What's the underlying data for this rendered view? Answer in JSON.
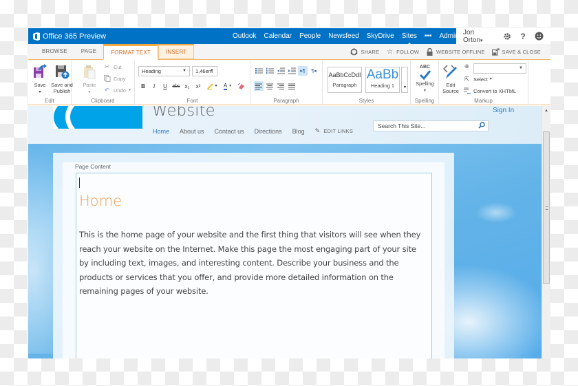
{
  "suite_bar": {
    "brand": "Office 365 Preview",
    "nav": [
      "Outlook",
      "Calendar",
      "People",
      "Newsfeed",
      "SkyDrive",
      "Sites",
      "•••",
      "Admin"
    ],
    "active_nav": "Sites",
    "user": "Jon Orton",
    "icons": [
      "gear-icon",
      "help-icon",
      "smiley-icon"
    ]
  },
  "ribbon_tabs": {
    "tabs": [
      "BROWSE",
      "PAGE",
      "FORMAT TEXT",
      "INSERT"
    ],
    "active": "FORMAT TEXT",
    "commands": [
      {
        "label": "SHARE",
        "icon": "share-icon"
      },
      {
        "label": "FOLLOW",
        "icon": "star-icon"
      },
      {
        "label": "WEBSITE OFFLINE",
        "icon": "lock-icon"
      },
      {
        "label": "SAVE & CLOSE",
        "icon": "save-close-icon"
      }
    ]
  },
  "ribbon": {
    "edit": {
      "label": "Edit",
      "save": "Save",
      "save_publish_line1": "Save and",
      "save_publish_line2": "Publish"
    },
    "clipboard": {
      "label": "Clipboard",
      "paste": "Paste",
      "cut": "Cut",
      "copy": "Copy",
      "undo": "Undo"
    },
    "font": {
      "label": "Font",
      "style_value": "Heading",
      "size_value": "1.46em",
      "buttons": [
        "B",
        "I",
        "U",
        "abc",
        "x₂",
        "x²"
      ]
    },
    "paragraph": {
      "label": "Paragraph"
    },
    "styles": {
      "label": "Styles",
      "items": [
        {
          "sample": "AaBbCcDdI",
          "name": "Paragraph"
        },
        {
          "sample": "AaBb",
          "name": "Heading 1"
        }
      ]
    },
    "spelling": {
      "label": "Spelling",
      "button": "Spelling",
      "abc": "ABC"
    },
    "markup": {
      "label": "Markup",
      "edit_source_line1": "Edit",
      "edit_source_line2": "Source",
      "select": "Select",
      "convert": "Convert to XHTML",
      "language_value": ""
    }
  },
  "site": {
    "title": "Website",
    "sign_in": "Sign In",
    "nav": [
      "Home",
      "About us",
      "Contact us",
      "Directions",
      "Blog"
    ],
    "active_nav": "Home",
    "edit_links": "EDIT LINKS",
    "search_placeholder": "Search This Site..."
  },
  "content": {
    "label": "Page Content",
    "heading": "Home",
    "body": "This is the home page of your website and the first thing that visitors will see when they reach your website on the Internet. Make this page the most engaging part of your site by including text, images, and interesting content. Describe your business and the products or services that you offer, and provide more detailed information on the remaining pages of your website."
  },
  "colors": {
    "suite_blue": "#0072c6",
    "ribbon_accent": "#f5a83f",
    "active_tab_text": "#d2691e",
    "link_blue": "#2a7ac2",
    "heading_orange": "#f39c50",
    "logo_blue": "#00a3e8"
  }
}
